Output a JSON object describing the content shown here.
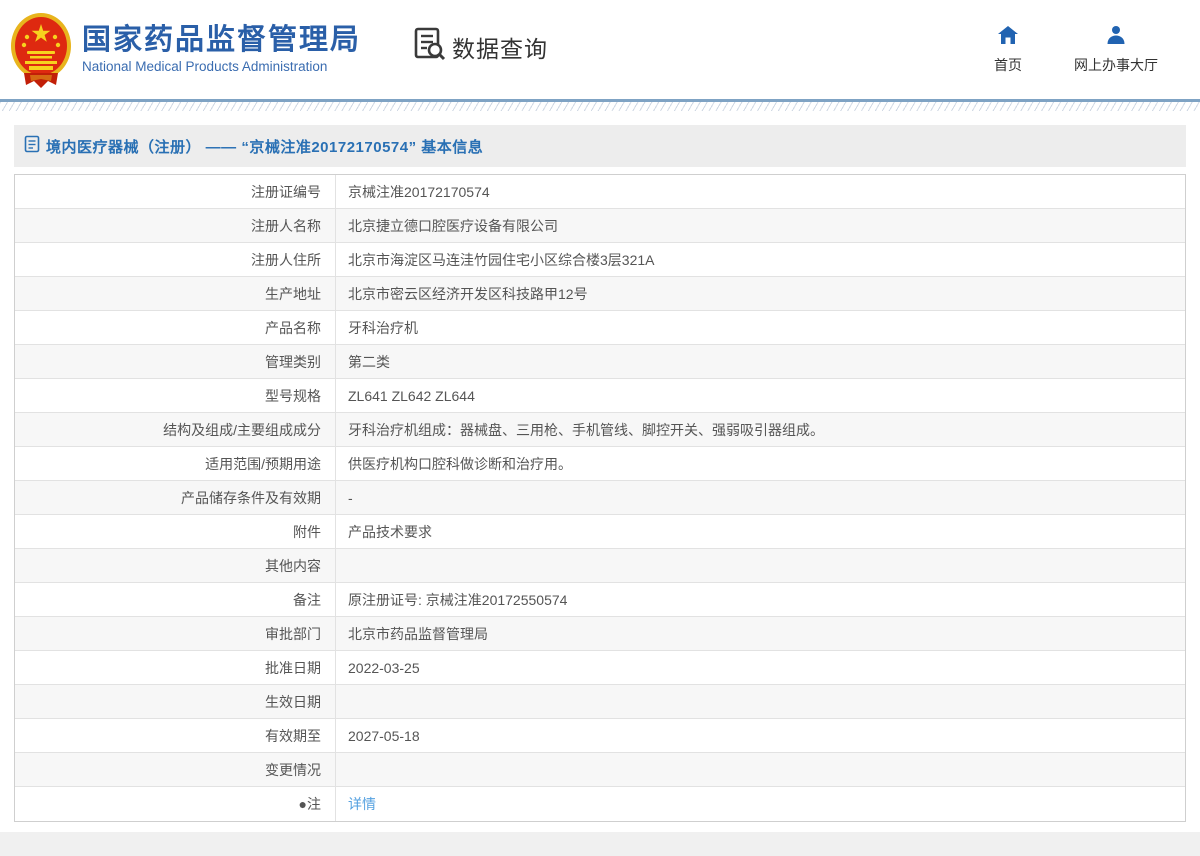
{
  "header": {
    "agency_name_zh": "国家药品监督管理局",
    "agency_name_en": "National Medical Products Administration",
    "query_label": "数据查询",
    "nav": [
      {
        "label": "首页",
        "icon": "home-icon"
      },
      {
        "label": "网上办事大厅",
        "icon": "user-icon"
      }
    ]
  },
  "page": {
    "title": "境内医疗器械（注册） —— “京械注准20172170574” 基本信息"
  },
  "table": {
    "rows": [
      {
        "label": "注册证编号",
        "value": "京械注准20172170574",
        "link": false
      },
      {
        "label": "注册人名称",
        "value": "北京捷立德口腔医疗设备有限公司",
        "link": false
      },
      {
        "label": "注册人住所",
        "value": "北京市海淀区马连洼竹园住宅小区综合楼3层321A",
        "link": false
      },
      {
        "label": "生产地址",
        "value": "北京市密云区经济开发区科技路甲12号",
        "link": false
      },
      {
        "label": "产品名称",
        "value": "牙科治疗机",
        "link": false
      },
      {
        "label": "管理类别",
        "value": "第二类",
        "link": false
      },
      {
        "label": "型号规格",
        "value": "ZL641 ZL642 ZL644",
        "link": false
      },
      {
        "label": "结构及组成/主要组成成分",
        "value": "牙科治疗机组成：器械盘、三用枪、手机管线、脚控开关、强弱吸引器组成。",
        "link": false
      },
      {
        "label": "适用范围/预期用途",
        "value": "供医疗机构口腔科做诊断和治疗用。",
        "link": false
      },
      {
        "label": "产品储存条件及有效期",
        "value": "-",
        "link": false
      },
      {
        "label": "附件",
        "value": "产品技术要求",
        "link": false
      },
      {
        "label": "其他内容",
        "value": "",
        "link": false
      },
      {
        "label": "备注",
        "value": "原注册证号: 京械注准20172550574",
        "link": false
      },
      {
        "label": "审批部门",
        "value": "北京市药品监督管理局",
        "link": false
      },
      {
        "label": "批准日期",
        "value": "2022-03-25",
        "link": false
      },
      {
        "label": "生效日期",
        "value": "",
        "link": false
      },
      {
        "label": "有效期至",
        "value": "2027-05-18",
        "link": false
      },
      {
        "label": "变更情况",
        "value": "",
        "link": false
      },
      {
        "label": "●注",
        "value": "详情",
        "link": true
      }
    ]
  },
  "colors": {
    "brand_blue": "#2a5fa8",
    "icon_blue": "#2163b1",
    "title_blue": "#2970b4",
    "link_blue": "#55a1e0",
    "divider_blue": "#7fa3c4",
    "title_bar_bg": "#ededed",
    "alt_row_bg": "#f7f7f7",
    "emblem_red": "#de2910",
    "emblem_gold": "#f0c02e"
  }
}
